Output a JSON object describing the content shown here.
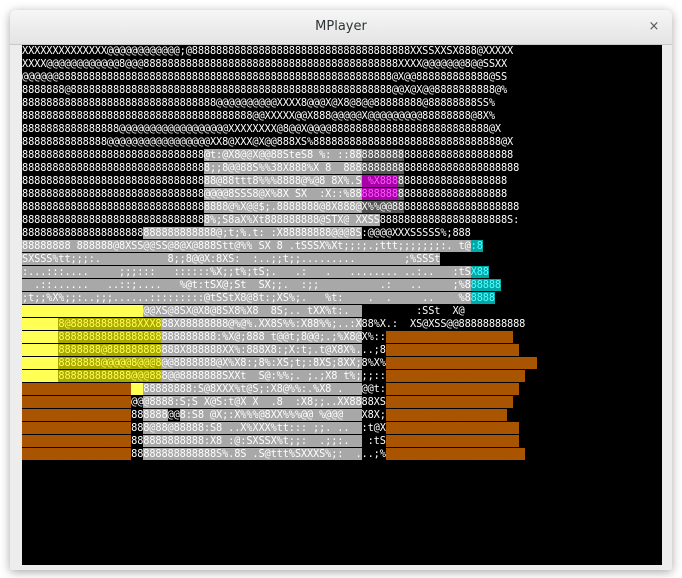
{
  "window": {
    "title": "MPlayer",
    "close_glyph": "×"
  },
  "video": {
    "rows": [
      "XXXXXXXXXXXXXX@@@@@@@@@@@@;@888888888888888888888888888888888888XXSSXXSX888@XXXXX",
      "XXXX@@@@@@@@@@@@8@@@888888888888888888888888888888888888888888XXXX@@@@@@@8@@SSXX",
      "@@@@@@8888888888888888888888888888888888888888888888888888888@X@@888888888888@SS",
      "8888888@88888888888888888888888888888888888888888888888888888@@X@X@@8888888888@%",
      "88888888888888888888888888888888@@@@@@@@@@XXXX8@@@X@X8@8@@88888888@88888888SS%",
      "88888888888888888888888888888888888888@@XXXXX@@X888@@@@@X@@@@@@@@@88888888@8X%",
      "8888888888888888@@@@@@@@@@@@@@@@@@XXXXXXXX@8@@X@@@@88888888888888888888888888@X",
      "88888888888888@@@@@@@@@@@@@@@@@XX8@XXX@X@@888XS%8888888888888888888888888888888@X",
      "888888888888888888888888888888@t:@X8@@X@@88SteS8 %: ::888888888888888888888888888",
      "8888888888888888888888888888888;;8@@88S%%38X888%X 8  88888888888888888888888888888",
      "88888888888888888888888888888888@88ttt8%%%8888@%@8 8X%.S %X888888888888888888888",
      "888888888888888888888888888888@@@@8SSS8@X%8X SX  :X::%88888888888888888888888888",
      "8888888888888888888888888888888888@%X@@$;.8888888@8X888@X%%@@888888888888888888888",
      "8888888888888888888888888888888%;S8aX%Xt888888888@STX@ XXSS888888888888888888888S:",
      "88888888888888888888888888888888@;t;%.t: :X88888888@@@8S:@@@@XXXSSSSS%;888",
      "88888888 888888@8XSS@@SS@8@X@888Stt@%% SX 8 .tSSSX%Xt;;:;.;ttt;;;;;;;:. t@:8",
      "SXSSS%tt;;;:.           8;;8@@X:8XS:  :..;;t;;.........        ;%SSSt",
      ":...:::....     ;;;:::   ::::::%X;;t%;tS;.   .:   .   ........ ..:..   :tSX88",
      "  .::......   ..::;....   %@t:tSX@;St  SX;;.  :;;          .:   ..     ;%888888",
      ";t;;%X%;;:..;;;......:::::::::@tSStX8@8t:;XS%;.   %t:    .  .     ..    %88888",
      "88@8888888888888@@@@@@XS@8SX@X8@8SX8%X8  8S;.. tXX%t:.           :SSt  X@",
      "88@8888@88888888888XXX888X88888888@%@%.XX8S%%:X88%%;..:X88%X.:  XS@XSS@@88888888888",
      "88X@8888888888888888888888888888:%X@;888 t@@t;8@@;.;%X8@X%:::;@XS@@8@8888888X@XSX",
      "88@8888888888@888888888888X888888XX%:888X8:;X:t;.t@X8X%...;88888888888888888888888",
      "X888888888888@@@@@8@@@8@@8888888@X%X8:;8%:XS;t;:8XS;8XX;8%X%8%%;..  88@@8@@8@88888888",
      "@@@@@8888888888888@@@888@@8888888SXXt  S@:%%;. ;.;X8 t%;;;::;;:.  X88 @@8@@@8888888",
      "X8X@@@8@@@8888XXX@@888888888:S@8XXX%t@S;:X8@%%:.%X8 .   @@t:;;:tXX%X.  88888888888",
      "888@8@@8@@8@88888@@@@8888:S;S X@S:t@X X  .8  :X8;;..XX8888XS%;X888888888888888888",
      "@@@@8@@@@@8@@@8888888888@@8:S8 @X;:X%%%@8XX%%%@@ %@@@   X8X;   @8888888888888888",
      "88888888@888888888888@88@88888:S8 ..X%XXX%tt::: ;;. ..  :t@XS8X%.:X8%: .@888888888",
      "888888888888888888888888888888:X8 :@:SXSSX%t;;:  .;;:.   :tS8X.S@X:  :8X8888888888",
      "88888888888888888888888888888888S%.8S .S@ttt%SXXXS%;:  ...;%XX888X SX@S;;;:88888888"
    ]
  }
}
